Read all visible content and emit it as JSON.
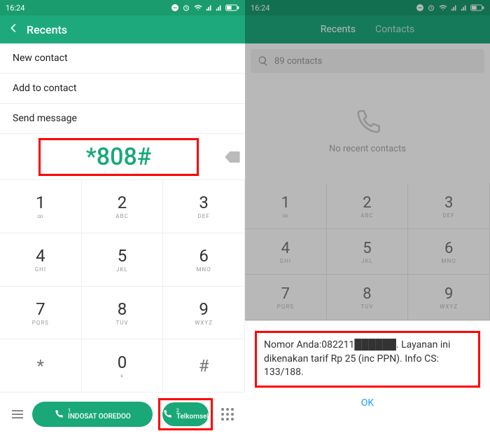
{
  "status": {
    "time": "16:24"
  },
  "left": {
    "title": "Recents",
    "menu": {
      "new_contact": "New contact",
      "add_to_contact": "Add to contact",
      "send_message": "Send message"
    },
    "dial_value": "*808#",
    "keys": [
      {
        "n": "1",
        "s": "∞"
      },
      {
        "n": "2",
        "s": "ABC"
      },
      {
        "n": "3",
        "s": "DEF"
      },
      {
        "n": "4",
        "s": "GHI"
      },
      {
        "n": "5",
        "s": "JKL"
      },
      {
        "n": "6",
        "s": "MNO"
      },
      {
        "n": "7",
        "s": "PQRS"
      },
      {
        "n": "8",
        "s": "TUV"
      },
      {
        "n": "9",
        "s": "WXYZ"
      },
      {
        "n": "*",
        "s": ""
      },
      {
        "n": "0",
        "s": "+"
      },
      {
        "n": "#",
        "s": ""
      }
    ],
    "sim1_label": "INDOSAT OOREDOO",
    "sim1_badge": "1",
    "sim2_label": "Telkomsel",
    "sim2_badge": "2"
  },
  "right": {
    "tabs": {
      "recents": "Recents",
      "contacts": "Contacts"
    },
    "search_placeholder": "89 contacts",
    "empty_text": "No recent contacts",
    "keys": [
      {
        "n": "1",
        "s": "∞"
      },
      {
        "n": "2",
        "s": "ABC"
      },
      {
        "n": "3",
        "s": "DEF"
      },
      {
        "n": "4",
        "s": "GHI"
      },
      {
        "n": "5",
        "s": "JKL"
      },
      {
        "n": "6",
        "s": "MNO"
      },
      {
        "n": "7",
        "s": "PQRS"
      },
      {
        "n": "8",
        "s": "TUV"
      },
      {
        "n": "9",
        "s": "WXYZ"
      }
    ],
    "dialog_text": "Nomor Anda:082211██████. Layanan ini dikenakan tarif Rp 25 (inc PPN). Info CS: 133/188.",
    "dialog_ok": "OK"
  }
}
